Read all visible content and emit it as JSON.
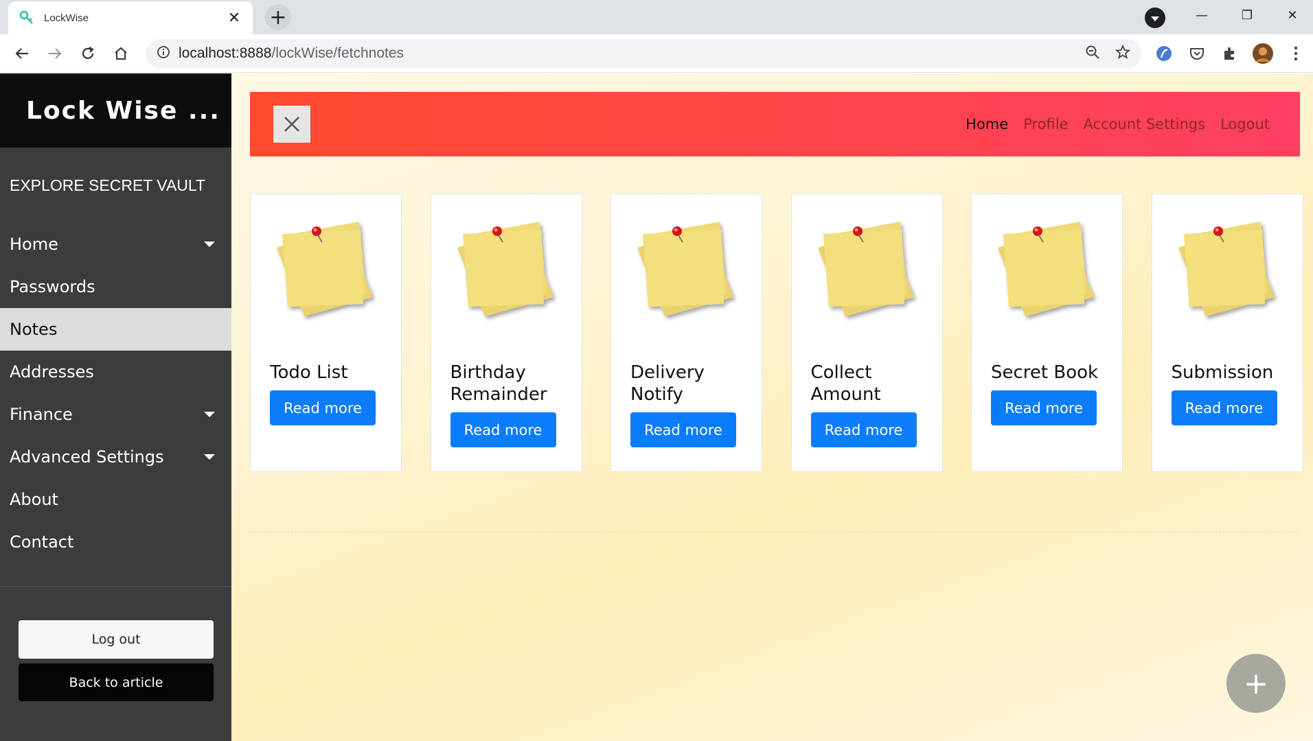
{
  "browser": {
    "tab_title": "LockWise",
    "tab_close": "✕",
    "new_tab": "+",
    "url_host": "localhost:8888",
    "url_path": "/lockWise/fetchnotes",
    "minimize": "—",
    "restore": "❐",
    "close": "✕"
  },
  "sidebar": {
    "brand": "Lock Wise ...",
    "section_title": "EXPLORE SECRET VAULT",
    "items": [
      {
        "label": "Home",
        "dropdown": true,
        "active": false
      },
      {
        "label": "Passwords",
        "dropdown": false,
        "active": false
      },
      {
        "label": "Notes",
        "dropdown": false,
        "active": true
      },
      {
        "label": "Addresses",
        "dropdown": false,
        "active": false
      },
      {
        "label": "Finance",
        "dropdown": true,
        "active": false
      },
      {
        "label": "Advanced Settings",
        "dropdown": true,
        "active": false
      },
      {
        "label": "About",
        "dropdown": false,
        "active": false
      },
      {
        "label": "Contact",
        "dropdown": false,
        "active": false
      }
    ],
    "logout_label": "Log out",
    "back_label": "Back to article"
  },
  "topnav": {
    "links": [
      "Home",
      "Profile",
      "Account Settings",
      "Logout"
    ],
    "active_link": "Home",
    "gradient_start": "#ff4a2e",
    "gradient_end": "#ff3f63"
  },
  "notes": [
    {
      "title": "Todo List",
      "button": "Read more"
    },
    {
      "title": "Birthday Remainder",
      "button": "Read more"
    },
    {
      "title": "Delivery Notify",
      "button": "Read more"
    },
    {
      "title": "Collect Amount",
      "button": "Read more"
    },
    {
      "title": "Secret Book",
      "button": "Read more"
    },
    {
      "title": "Submission",
      "button": "Read more"
    }
  ],
  "fab_label": "+",
  "colors": {
    "accent_button": "#0a7cfc",
    "sidebar_bg": "#3c3c3c",
    "brand_bg": "#0d0d0d"
  }
}
